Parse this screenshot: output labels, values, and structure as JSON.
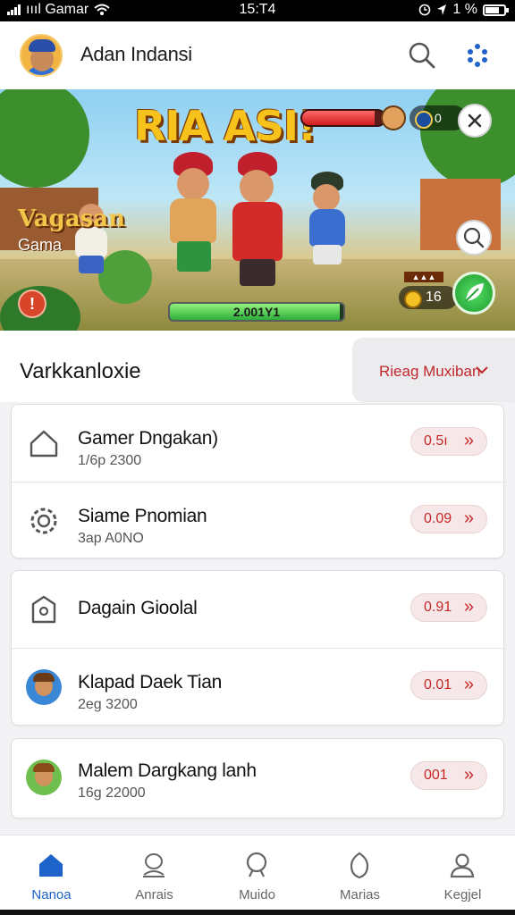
{
  "status_bar": {
    "carrier": "ıııl Gamar",
    "time": "15:T4",
    "battery_text": "1 %"
  },
  "header": {
    "title": "Adan Indansi"
  },
  "banner": {
    "title": "RIA ASI!",
    "game_label_line1": "Vagasan",
    "game_label_line2": "Gama",
    "coins": "0",
    "score": "16",
    "progress_label": "2.001Y1",
    "progress_fraction": 0.98,
    "health_fraction": 0.88,
    "shop_tag": "▲▲▲"
  },
  "section": {
    "title": "Varkkanloxie",
    "sort_label": "Rieag Muxiban"
  },
  "cards": [
    {
      "rows": [
        {
          "name": "Gamer Dngakan)",
          "sub": "1/6p 2300",
          "value": "0.5ı",
          "icon": "home-icon"
        },
        {
          "name": "Siame Pnomian",
          "sub": "3ap A0NO",
          "value": "0.09",
          "icon": "gear-icon"
        }
      ]
    },
    {
      "rows": [
        {
          "name": "Dagain Gioolal",
          "sub": "",
          "value": "0.91",
          "icon": "tag-icon"
        },
        {
          "name": "Klapad Daek Tian",
          "sub": "2eg 3200",
          "value": "0.01",
          "icon": "avatar-icon"
        }
      ]
    },
    {
      "rows": [
        {
          "name": "Malem Dargkang lanh",
          "sub": "16g 22000",
          "value": "001",
          "icon": "avatar-icon"
        }
      ]
    }
  ],
  "tabs": [
    {
      "label": "Nanoa",
      "icon": "home-icon",
      "active": true
    },
    {
      "label": "Anrais",
      "icon": "trophy-icon",
      "active": false
    },
    {
      "label": "Muido",
      "icon": "search-icon",
      "active": false
    },
    {
      "label": "Marias",
      "icon": "shield-icon",
      "active": false
    },
    {
      "label": "Kegjel",
      "icon": "user-icon",
      "active": false
    }
  ],
  "colors": {
    "accent": "#1e63c9",
    "danger": "#c62828"
  }
}
